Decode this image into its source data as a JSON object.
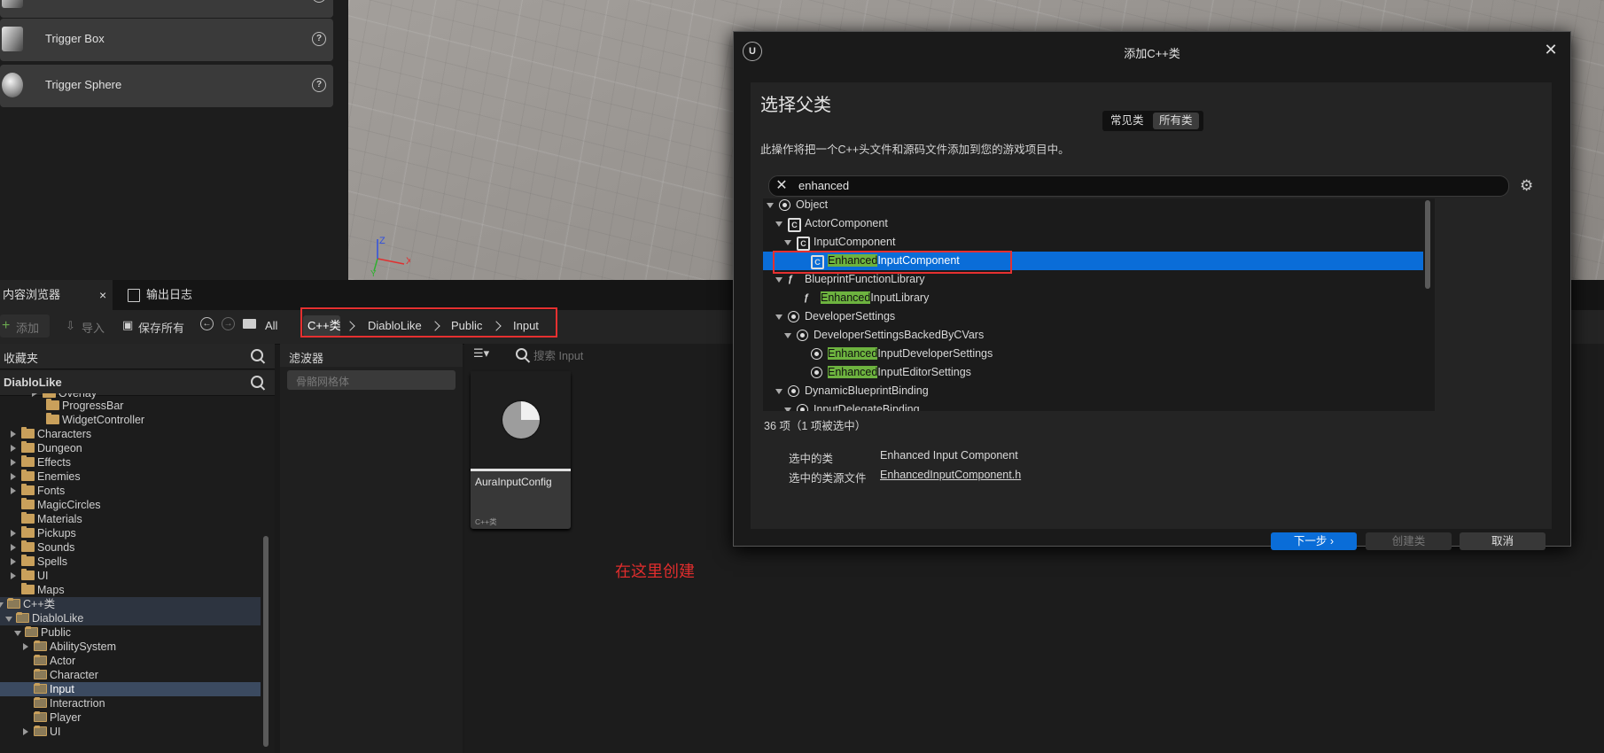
{
  "place_panel": {
    "items": [
      {
        "label": "Trigger Box",
        "icon": "cube-icon"
      },
      {
        "label": "Trigger Sphere",
        "icon": "sphere-icon"
      }
    ]
  },
  "viewport": {
    "axis_x": "X",
    "axis_y": "Y",
    "axis_z": "Z"
  },
  "content_browser": {
    "tabs": [
      {
        "label": "内容浏览器"
      },
      {
        "label": "输出日志"
      }
    ],
    "toolbar": {
      "add_label": "添加",
      "import_label": "导入",
      "save_all_label": "保存所有",
      "breadcrumb": [
        "All",
        "C++类",
        "DiabloLike",
        "Public",
        "Input"
      ]
    },
    "favorites_label": "收藏夹",
    "project_label": "DiabloLike",
    "tree": [
      {
        "label": "Overlay"
      },
      {
        "label": "ProgressBar"
      },
      {
        "label": "WidgetController"
      },
      {
        "label": "Characters"
      },
      {
        "label": "Dungeon"
      },
      {
        "label": "Effects"
      },
      {
        "label": "Enemies"
      },
      {
        "label": "Fonts"
      },
      {
        "label": "MagicCircles"
      },
      {
        "label": "Materials"
      },
      {
        "label": "Pickups"
      },
      {
        "label": "Sounds"
      },
      {
        "label": "Spells"
      },
      {
        "label": "UI"
      },
      {
        "label": "Maps"
      },
      {
        "label": "C++类"
      },
      {
        "label": "DiabloLike"
      },
      {
        "label": "Public"
      },
      {
        "label": "AbilitySystem"
      },
      {
        "label": "Actor"
      },
      {
        "label": "Character"
      },
      {
        "label": "Input"
      },
      {
        "label": "Interactrion"
      },
      {
        "label": "Player"
      },
      {
        "label": "UI"
      }
    ],
    "filters_label": "滤波器",
    "filter_placeholder": "骨骼网格体",
    "search_placeholder": "搜索 Input",
    "asset": {
      "name": "AuraInputConfig",
      "type": "C++类"
    }
  },
  "annotation": "在这里创建",
  "dialog": {
    "title": "添加C++类",
    "heading": "选择父类",
    "seg_common": "常见类",
    "seg_all": "所有类",
    "description": "此操作将把一个C++头文件和源码文件添加到您的游戏项目中。",
    "search_value": "enhanced",
    "class_tree": [
      {
        "pre": "",
        "hl": "",
        "post": "Object"
      },
      {
        "pre": "",
        "hl": "",
        "post": "ActorComponent"
      },
      {
        "pre": "",
        "hl": "",
        "post": "InputComponent"
      },
      {
        "pre": "",
        "hl": "Enhanced",
        "post": "InputComponent"
      },
      {
        "pre": "",
        "hl": "",
        "post": "BlueprintFunctionLibrary"
      },
      {
        "pre": "",
        "hl": "Enhanced",
        "post": "InputLibrary"
      },
      {
        "pre": "",
        "hl": "",
        "post": "DeveloperSettings"
      },
      {
        "pre": "",
        "hl": "",
        "post": "DeveloperSettingsBackedByCVars"
      },
      {
        "pre": "",
        "hl": "Enhanced",
        "post": "InputDeveloperSettings"
      },
      {
        "pre": "",
        "hl": "Enhanced",
        "post": "InputEditorSettings"
      },
      {
        "pre": "",
        "hl": "",
        "post": "DynamicBlueprintBinding"
      },
      {
        "pre": "",
        "hl": "",
        "post": "InputDelegateBinding"
      }
    ],
    "count_text": "36 项（1 项被选中）",
    "selected_class_label": "选中的类",
    "selected_class_value": "Enhanced Input Component",
    "selected_source_label": "选中的类源文件",
    "selected_source_value": "EnhancedInputComponent.h",
    "next_label": "下一步",
    "create_label": "创建类",
    "cancel_label": "取消",
    "accent_color": "#0a6dd8",
    "highlight_color": "#6db33f"
  }
}
